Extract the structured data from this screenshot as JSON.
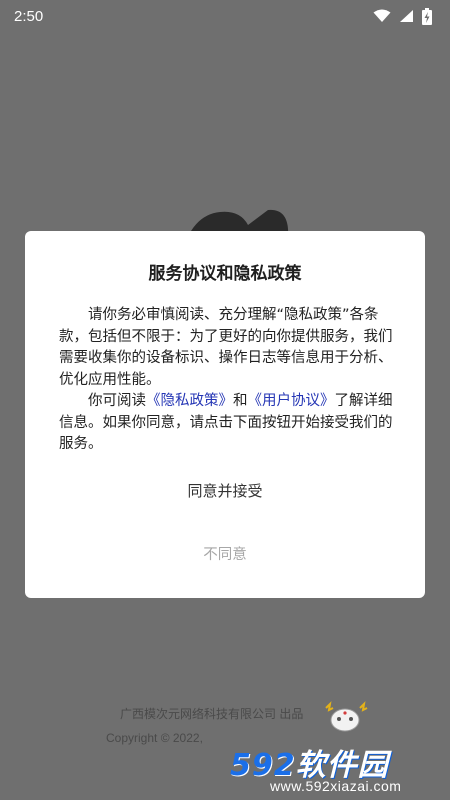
{
  "status_bar": {
    "time": "2:50",
    "icons": [
      "wifi-icon",
      "signal-icon",
      "battery-charging-icon"
    ]
  },
  "dialog": {
    "title": "服务协议和隐私政策",
    "para1": "请你务必审慎阅读、充分理解“隐私政策”各条款，包括但不限于：为了更好的向你提供服务，我们需要收集你的设备标识、操作日志等信息用于分析、优化应用性能。",
    "para2_prefix": "你可阅读",
    "privacy_link": "《隐私政策》",
    "para2_and": "和",
    "user_agreement_link": "《用户协议》",
    "para2_suffix": "了解详细信息。如果你同意，请点击下面按钮开始接受我们的服务。",
    "agree_label": "同意并接受",
    "disagree_label": "不同意",
    "link_color": "#2536b5"
  },
  "footer": {
    "line1": "广西模次元网络科技有限公司 出品",
    "line2": "Copyright © 2022,"
  },
  "watermark": {
    "brand_num": "592",
    "brand_text": "软件园",
    "url": "www.592xiazai.com"
  }
}
